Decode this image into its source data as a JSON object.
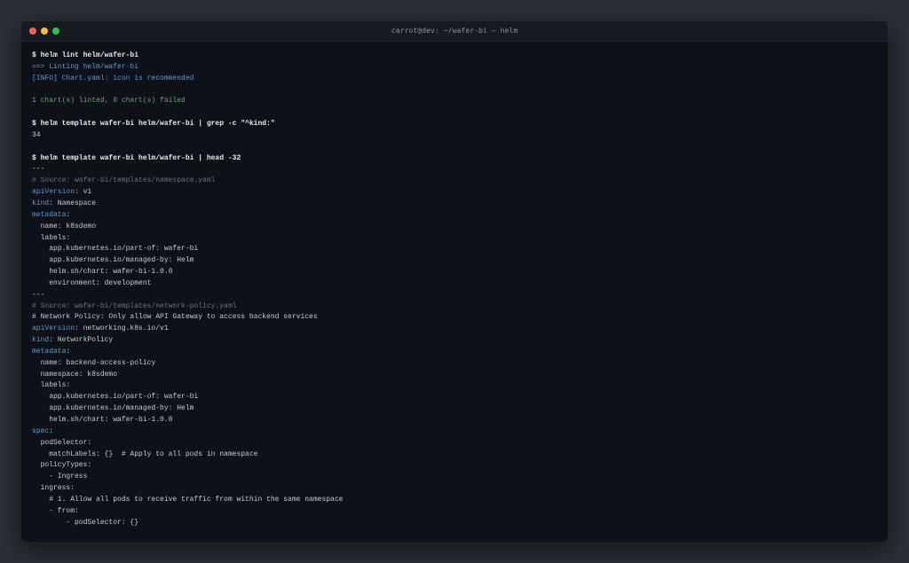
{
  "window": {
    "title": "carrot@dev: ~/wafer-bi — helm",
    "lights": [
      "#fe5f57",
      "#febc2e",
      "#28c840"
    ]
  },
  "colors": {
    "background": "#0e1117",
    "command": "#e8ecf1",
    "key": "#569cd6",
    "comment": "#6a7380",
    "success": "#5fae62",
    "text": "#c5cbd3"
  },
  "lines": [
    {
      "segments": [
        {
          "text": "$ helm lint helm/wafer-bi",
          "style": "cmd"
        }
      ]
    },
    {
      "segments": [
        {
          "text": "==> Linting helm/wafer-bi",
          "style": "blue"
        }
      ]
    },
    {
      "segments": [
        {
          "text": "[INFO] Chart.yaml: icon is recommended",
          "style": "blue"
        }
      ]
    },
    {
      "segments": [
        {
          "text": "",
          "style": "plain"
        }
      ]
    },
    {
      "segments": [
        {
          "text": "1 chart(s) linted, 0 chart(s) failed",
          "style": "green"
        }
      ]
    },
    {
      "segments": [
        {
          "text": "",
          "style": "plain"
        }
      ]
    },
    {
      "segments": [
        {
          "text": "$ helm template wafer-bi helm/wafer-bi | grep -c \"^kind:\"",
          "style": "cmd"
        }
      ]
    },
    {
      "segments": [
        {
          "text": "34",
          "style": "plain"
        }
      ]
    },
    {
      "segments": [
        {
          "text": "",
          "style": "plain"
        }
      ]
    },
    {
      "segments": [
        {
          "text": "$ helm template wafer-bi helm/wafer-bi | head -32",
          "style": "cmd"
        }
      ]
    },
    {
      "segments": [
        {
          "text": "---",
          "style": "plain"
        }
      ]
    },
    {
      "segments": [
        {
          "text": "# Source: wafer-bi/templates/namespace.yaml",
          "style": "comment"
        }
      ]
    },
    {
      "segments": [
        {
          "text": "apiVersion",
          "style": "key"
        },
        {
          "text": ": v1",
          "style": "plain"
        }
      ]
    },
    {
      "segments": [
        {
          "text": "kind",
          "style": "key"
        },
        {
          "text": ": Namespace",
          "style": "plain"
        }
      ]
    },
    {
      "segments": [
        {
          "text": "metadata",
          "style": "key"
        },
        {
          "text": ":",
          "style": "plain"
        }
      ]
    },
    {
      "segments": [
        {
          "text": "  name: k8sdemo",
          "style": "plain"
        }
      ]
    },
    {
      "segments": [
        {
          "text": "  labels:",
          "style": "plain"
        }
      ]
    },
    {
      "segments": [
        {
          "text": "    app.kubernetes.io/part-of: wafer-bi",
          "style": "plain"
        }
      ]
    },
    {
      "segments": [
        {
          "text": "    app.kubernetes.io/managed-by: Helm",
          "style": "plain"
        }
      ]
    },
    {
      "segments": [
        {
          "text": "    helm.sh/chart: wafer-bi-1.0.0",
          "style": "plain"
        }
      ]
    },
    {
      "segments": [
        {
          "text": "    environment: development",
          "style": "plain"
        }
      ]
    },
    {
      "segments": [
        {
          "text": "---",
          "style": "plain"
        }
      ]
    },
    {
      "segments": [
        {
          "text": "# Source: wafer-bi/templates/network-policy.yaml",
          "style": "comment"
        }
      ]
    },
    {
      "segments": [
        {
          "text": "# Network Policy: Only allow API Gateway to access backend services",
          "style": "plain"
        }
      ]
    },
    {
      "segments": [
        {
          "text": "apiVersion",
          "style": "key"
        },
        {
          "text": ": networking.k8s.io/v1",
          "style": "plain"
        }
      ]
    },
    {
      "segments": [
        {
          "text": "kind",
          "style": "key"
        },
        {
          "text": ": NetworkPolicy",
          "style": "plain"
        }
      ]
    },
    {
      "segments": [
        {
          "text": "metadata",
          "style": "key"
        },
        {
          "text": ":",
          "style": "plain"
        }
      ]
    },
    {
      "segments": [
        {
          "text": "  name: backend-access-policy",
          "style": "plain"
        }
      ]
    },
    {
      "segments": [
        {
          "text": "  namespace: k8sdemo",
          "style": "plain"
        }
      ]
    },
    {
      "segments": [
        {
          "text": "  labels:",
          "style": "plain"
        }
      ]
    },
    {
      "segments": [
        {
          "text": "    app.kubernetes.io/part-of: wafer-bi",
          "style": "plain"
        }
      ]
    },
    {
      "segments": [
        {
          "text": "    app.kubernetes.io/managed-by: Helm",
          "style": "plain"
        }
      ]
    },
    {
      "segments": [
        {
          "text": "    helm.sh/chart: wafer-bi-1.0.0",
          "style": "plain"
        }
      ]
    },
    {
      "segments": [
        {
          "text": "spec",
          "style": "key"
        },
        {
          "text": ":",
          "style": "plain"
        }
      ]
    },
    {
      "segments": [
        {
          "text": "  podSelector:",
          "style": "plain"
        }
      ]
    },
    {
      "segments": [
        {
          "text": "    matchLabels: {}  # Apply to all pods in namespace",
          "style": "plain"
        }
      ]
    },
    {
      "segments": [
        {
          "text": "  policyTypes:",
          "style": "plain"
        }
      ]
    },
    {
      "segments": [
        {
          "text": "    - Ingress",
          "style": "plain"
        }
      ]
    },
    {
      "segments": [
        {
          "text": "  ingress:",
          "style": "plain"
        }
      ]
    },
    {
      "segments": [
        {
          "text": "    # 1. Allow all pods to receive traffic from within the same namespace",
          "style": "plain"
        }
      ]
    },
    {
      "segments": [
        {
          "text": "    - from:",
          "style": "plain"
        }
      ]
    },
    {
      "segments": [
        {
          "text": "        - podSelector: {}",
          "style": "plain"
        }
      ]
    }
  ]
}
